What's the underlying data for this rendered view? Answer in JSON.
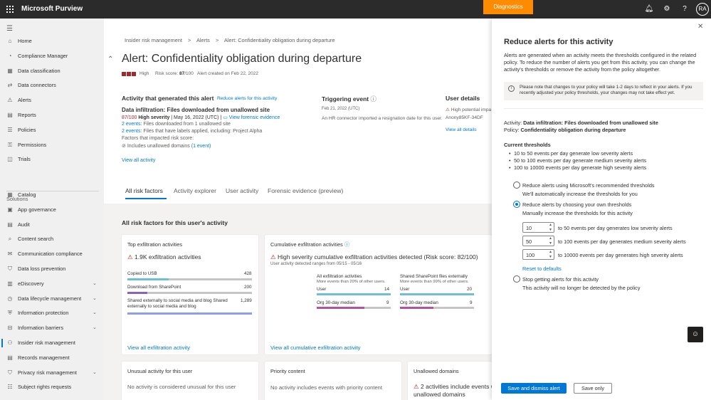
{
  "app": {
    "title": "Microsoft Purview",
    "diagnostics": "Diagnostics",
    "avatar": "RA"
  },
  "nav": {
    "items": [
      {
        "name": "nav-home",
        "icon": "⌂",
        "label": "Home"
      },
      {
        "name": "nav-compliance-manager",
        "icon": "◔",
        "label": "Compliance Manager"
      },
      {
        "name": "nav-data-classification",
        "icon": "▦",
        "label": "Data classification"
      },
      {
        "name": "nav-data-connectors",
        "icon": "⇄",
        "label": "Data connectors"
      },
      {
        "name": "nav-alerts",
        "icon": "⚠",
        "label": "Alerts"
      },
      {
        "name": "nav-reports",
        "icon": "▤",
        "label": "Reports"
      },
      {
        "name": "nav-policies",
        "icon": "☰",
        "label": "Policies"
      },
      {
        "name": "nav-permissions",
        "icon": "⚿",
        "label": "Permissions"
      },
      {
        "name": "nav-trials",
        "icon": "◫",
        "label": "Trials"
      }
    ],
    "solutions_heading": "Solutions",
    "solutions": [
      {
        "name": "nav-catalog",
        "icon": "▦",
        "label": "Catalog",
        "chev": ""
      },
      {
        "name": "nav-app-governance",
        "icon": "▣",
        "label": "App governance",
        "chev": ""
      },
      {
        "name": "nav-audit",
        "icon": "▤",
        "label": "Audit",
        "chev": ""
      },
      {
        "name": "nav-content-search",
        "icon": "⌕",
        "label": "Content search",
        "chev": ""
      },
      {
        "name": "nav-communication-compliance",
        "icon": "✉",
        "label": "Communication compliance",
        "chev": ""
      },
      {
        "name": "nav-data-loss-prevention",
        "icon": "⛉",
        "label": "Data loss prevention",
        "chev": ""
      },
      {
        "name": "nav-ediscovery",
        "icon": "▥",
        "label": "eDiscovery",
        "chev": "⌄"
      },
      {
        "name": "nav-data-lifecycle-management",
        "icon": "◷",
        "label": "Data lifecycle management",
        "chev": "⌄"
      },
      {
        "name": "nav-information-protection",
        "icon": "⛨",
        "label": "Information protection",
        "chev": "⌄"
      },
      {
        "name": "nav-information-barriers",
        "icon": "⊟",
        "label": "Information barriers",
        "chev": "⌄"
      },
      {
        "name": "nav-insider-risk-management",
        "icon": "⚇",
        "label": "Insider risk management",
        "chev": ""
      },
      {
        "name": "nav-records-management",
        "icon": "▤",
        "label": "Records management",
        "chev": ""
      },
      {
        "name": "nav-privacy-risk-management",
        "icon": "⛉",
        "label": "Privacy risk management",
        "chev": "⌄"
      },
      {
        "name": "nav-subject-rights-requests",
        "icon": "☷",
        "label": "Subject rights requests",
        "chev": ""
      }
    ]
  },
  "main": {
    "breadcrumb": [
      "Insider risk management",
      ">",
      "Alerts",
      ">",
      "Alert: Confidentiality obligation during departure"
    ],
    "title": "Alert: Confidentiality obligation during departure",
    "severity": "High",
    "risk_score_label": "Risk score: ",
    "risk_score": "87",
    "risk_score_max": "/100",
    "created": "Alert created on Feb 22, 2022",
    "activity_heading": "Activity that generated this alert",
    "reduce_link": "Reduce alerts for this activity",
    "activity_name": "Data infiltration: Files downloaded from unallowed site",
    "activity_score": "87/100",
    "activity_sev": "High severity",
    "activity_date": "| May 16, 2022 (UTC) |",
    "forensic_link": "View forensic evidence",
    "events1_link": "2 events:",
    "events1_text": "Files downloaded from 1 unallowed site",
    "events2_link": "2 events:",
    "events2_text": "Files that have labels applied, including: Project Alpha",
    "factors_label": "Factors that impacted risk score:",
    "factor1": "Includes unallowed domains",
    "factor1_link": "(1 event)",
    "view_all_activity": "View all activity",
    "trigger_heading": "Triggering event",
    "trigger_date": "Feb 21, 2022 (UTC)",
    "trigger_text": "An HR connector imported a resignation date for this user.",
    "user_heading": "User details",
    "user_flag": "High potential impa",
    "user_id": "Anony85KF-34DF",
    "view_all_details": "View all details",
    "tabs": [
      "All risk factors",
      "Activity explorer",
      "User activity",
      "Forensic evidence (preview)"
    ],
    "section_title": "All risk factors for this user's activity",
    "top_exfil": {
      "title": "Top exfiltration activities",
      "headline": "1.9K exfiltration activities",
      "rows": [
        {
          "label": "Copied to USB",
          "value": "428",
          "pct": 0.33
        },
        {
          "label": "Download from SharePoint",
          "value": "200",
          "pct": 0.16
        },
        {
          "label": "Shared externally to social media and blog Shared externally to social media and blog",
          "value": "1,289",
          "pct": 1.0
        }
      ],
      "link": "View all exfiltration activity"
    },
    "cumulative": {
      "title": "Cumulative exfiltration activities",
      "headline": "High severity cumulative exfiltration activities detected (Risk score: 82/100)",
      "range": "User activity detected ranges from 05/15 - 05/16",
      "col1_title": "All exfiltration activities",
      "col1_sub": "More events than 20% of other users.",
      "col1_user": "User",
      "col1_user_val": "14",
      "col1_org": "Org 30-day median",
      "col1_org_val": "9",
      "col2_title": "Shared SharePoint files externally",
      "col2_sub": "More events than 99% of other users.",
      "col2_user": "User",
      "col2_user_val": "20",
      "col2_org": "Org 30-day median",
      "col2_org_val": "9",
      "link": "View all cumulative exfiltration activity"
    },
    "unusual": {
      "title": "Unusual activity for this user",
      "text": "No activity is considered unusual for this user"
    },
    "priority": {
      "title": "Priority content",
      "text": "No activity includes events with priority content"
    },
    "unallowed": {
      "title": "Unallowed domains",
      "text": "2 activities include events with unallowed domains"
    }
  },
  "panel": {
    "title": "Reduce alerts for this activity",
    "description": "Alerts are generated when an activity meets the thresholds configured in the related policy. To reduce the number of alerts you get from this activity, you can change the activity's thresholds or remove the activity from the policy altogether.",
    "notice": "Please note that changes to your policy will take 1-2 days to reflect in your alerts. If you recently adjusted your policy thresholds, your changes may not take effect yet.",
    "activity_label": "Activity: ",
    "activity_value": "Data infiltration: Files downloaded from unallowed site",
    "policy_label": "Policy: ",
    "policy_value": "Confidentiality obligation during departure",
    "current_heading": "Current thresholds",
    "thresholds": [
      "10 to 50 events per day generate low severity alerts",
      "50 to 100 events per day generate medium severity alerts",
      "100 to 10000 events per day generate high severity alerts"
    ],
    "opt1_label": "Reduce alerts using Microsoft's recommended thresholds",
    "opt1_sub": "We'll automatically increase the thresholds for you",
    "opt2_label": "Reduce alerts by choosing your own thresholds",
    "opt2_sub": "Manually increase the thresholds for this activity",
    "spinners": [
      {
        "value": "10",
        "label": "to 50 events per day generates low severity alerts"
      },
      {
        "value": "50",
        "label": "to 100 events per day generates medium severity alerts"
      },
      {
        "value": "100",
        "label": "to 10000 events per day generates high severity alerts"
      }
    ],
    "reset": "Reset to defaults",
    "opt3_label": "Stop getting alerts for this activity",
    "opt3_sub": "This activity will no longer be detected by the policy",
    "save_dismiss": "Save and dismiss alert",
    "save_only": "Save only",
    "selected_option": "opt2"
  }
}
